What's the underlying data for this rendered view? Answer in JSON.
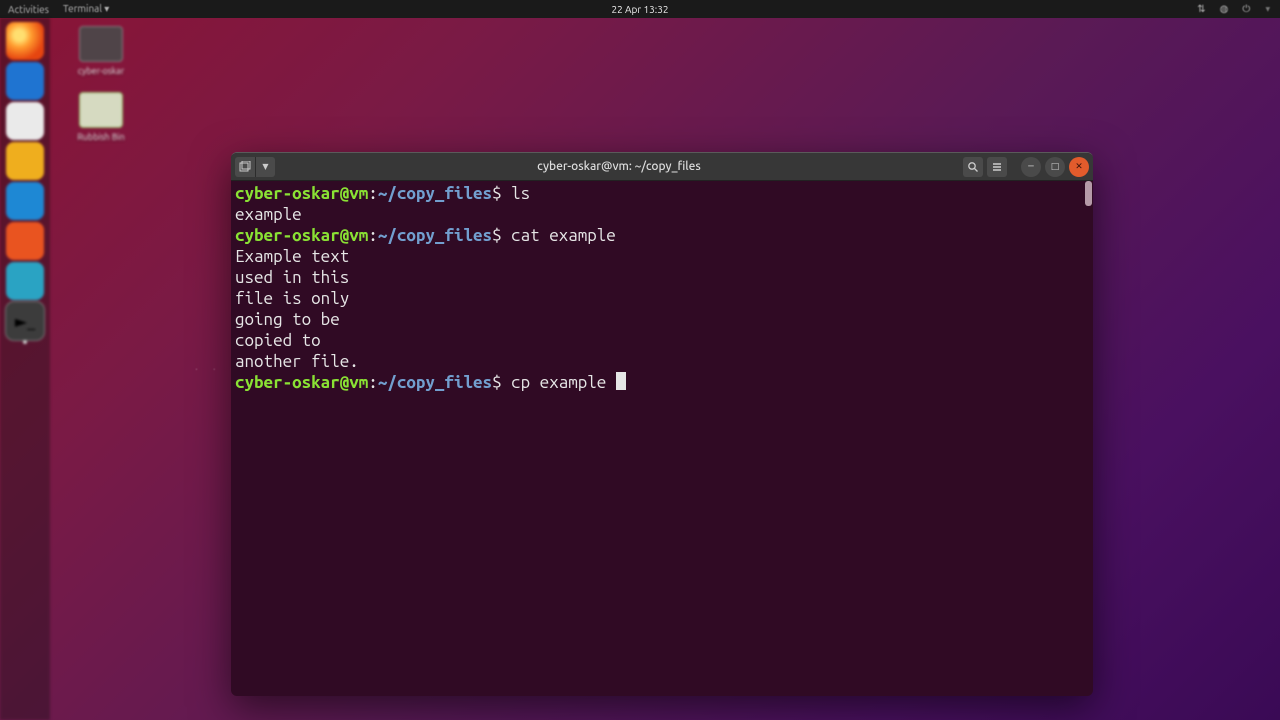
{
  "topbar": {
    "activities": "Activities",
    "app_indicator": "Terminal ▾",
    "datetime": "22 Apr  13:32"
  },
  "desktop": {
    "icon1_label": "cyber-oskar",
    "icon2_label": "Rubbish Bin"
  },
  "terminal": {
    "title": "cyber-oskar@vm: ~/copy_files",
    "prompt_user": "cyber-oskar@vm",
    "prompt_colon": ":",
    "prompt_path": "~/copy_files",
    "prompt_dollar": "$ ",
    "lines": {
      "cmd1": "ls",
      "out1": "example",
      "cmd2": "cat example",
      "out2a": "Example text",
      "out2b": "used in this",
      "out2c": "file is only",
      "out2d": "going to be",
      "out2e": "copied to",
      "out2f": "another file.",
      "cmd3": "cp example "
    }
  }
}
